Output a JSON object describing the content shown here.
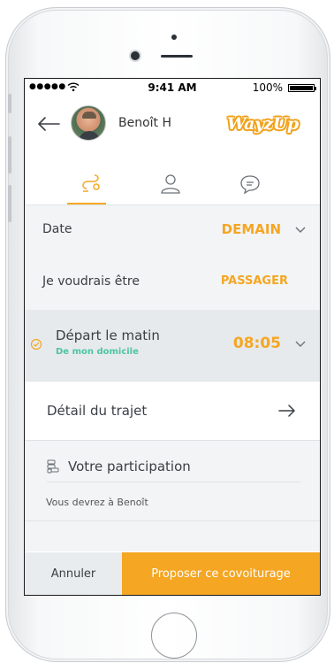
{
  "status_bar": {
    "signal": "●●●●●",
    "time": "9:41 AM",
    "battery": "100%"
  },
  "header": {
    "back_icon": "arrow-left-icon",
    "driver_name": "Benoît H",
    "logo_text": "WayzUp"
  },
  "tabs": [
    {
      "icon": "route-icon",
      "active": true
    },
    {
      "icon": "person-icon",
      "active": false
    },
    {
      "icon": "chat-bubble-icon",
      "active": false
    }
  ],
  "form": {
    "date_label": "Date",
    "date_value": "DEMAIN",
    "role_label": "Je voudrais être",
    "role_value": "PASSAGER",
    "departure_label": "Départ le matin",
    "departure_sublabel": "De mon domicile",
    "departure_time": "08:05",
    "detail_label": "Détail du trajet",
    "participation_title": "Votre participation",
    "participation_text": "Vous devrez à Benoît"
  },
  "footer": {
    "cancel_label": "Annuler",
    "propose_label": "Proposer ce covoiturage"
  },
  "colors": {
    "accent": "#f5a623",
    "secondary": "#4fc4a5",
    "row_background": "#f2f4f5"
  }
}
